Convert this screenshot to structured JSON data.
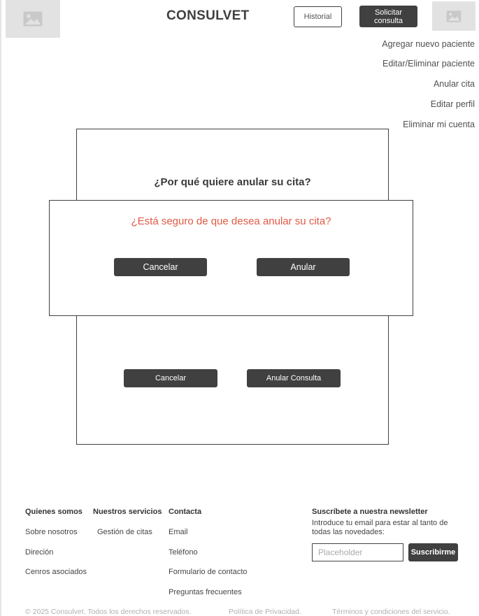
{
  "header": {
    "brand": "CONSULVET",
    "historial_label": "Historial",
    "solicitar_label": "Solicitar consulta"
  },
  "menu": {
    "items": [
      "Agregar nuevo paciente",
      "Editar/Eliminar paciente",
      "Anular cita",
      "Editar perfil",
      "Eliminar mi cuenta"
    ]
  },
  "panel": {
    "title": "¿Por qué quiere anular su cita?",
    "cancel_label": "Cancelar",
    "confirm_label": "Anular Consulta"
  },
  "modal": {
    "question": "¿Está seguro de que desea anular su cita?",
    "cancel_label": "Cancelar",
    "confirm_label": "Anular",
    "question_color": "#e05a44"
  },
  "footer": {
    "col1": {
      "heading": "Quienes somos",
      "links": [
        "Sobre nosotros",
        "Direción",
        "Cenros asociados"
      ]
    },
    "col2": {
      "heading": "Nuestros servicios",
      "links": [
        "Gestión de citas"
      ]
    },
    "col3": {
      "heading": "Contacta",
      "links": [
        "Email",
        "Teléfono",
        "Formulario de contacto",
        "Preguntas frecuentes"
      ]
    },
    "newsletter": {
      "heading": "Suscríbete a nuestra newsletter",
      "description": "Introduce tu email para estar al tanto de todas las novedades:",
      "placeholder": "Placeholder",
      "button_label": "Suscribirme"
    },
    "legal": {
      "copyright": "© 2025 Consulvet. Todos los derechos reservados.",
      "privacy": "Política de Privacidad.",
      "terms": "Términos y condiciones del servicio."
    }
  },
  "icons": {
    "logo_placeholder": "image-placeholder-icon",
    "avatar_placeholder": "image-placeholder-icon"
  },
  "colors": {
    "dark_button": "#404040",
    "placeholder_bg": "#e2e2e2",
    "accent_question": "#e05a44"
  }
}
